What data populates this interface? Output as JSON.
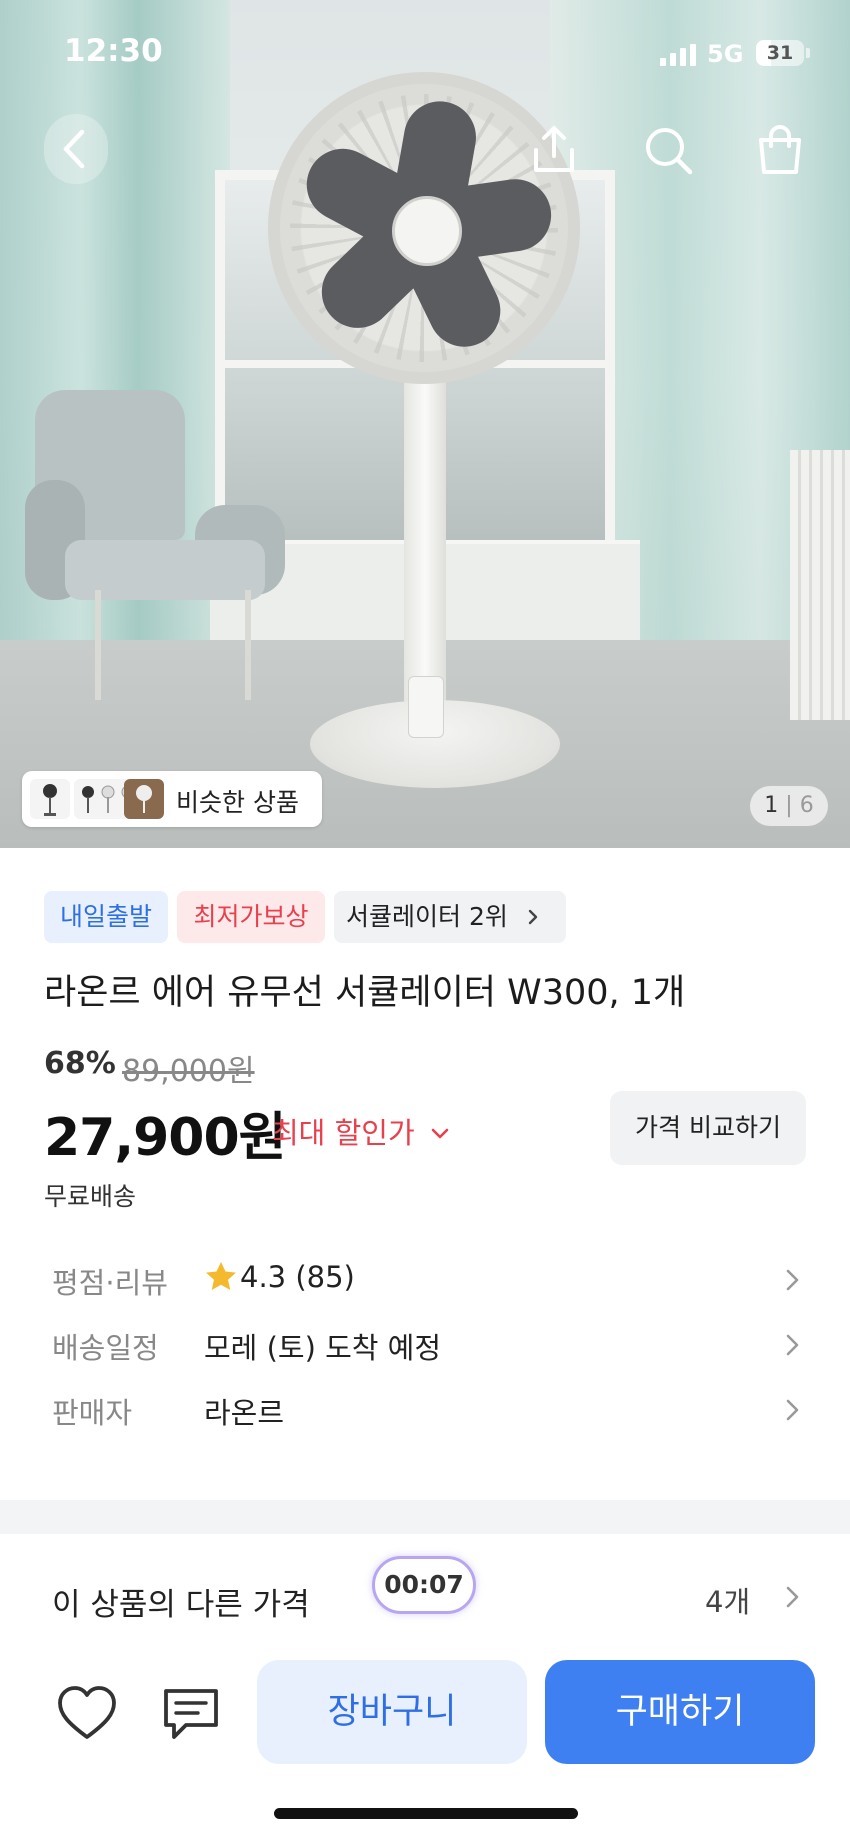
{
  "status_bar": {
    "time": "12:30",
    "network": "5G",
    "battery": "31",
    "battery_level": 0.31
  },
  "hero": {
    "similar_label": "비슷한 상품",
    "page_current": "1",
    "page_sep": "|",
    "page_total": "6"
  },
  "badges": {
    "delivery": "내일출발",
    "lowest_price": "최저가보상",
    "ranking": "서큘레이터 2위"
  },
  "product": {
    "title": "라온르 에어 유무선 서큘레이터 W300, 1개",
    "discount_rate": "68%",
    "original_price": "89,000원",
    "price": "27,900원",
    "max_discount_label": "최대 할인가",
    "compare_button": "가격 비교하기",
    "shipping": "무료배송"
  },
  "info": {
    "rating_label": "평점·리뷰",
    "rating_value": "4.3 (85)",
    "delivery_label": "배송일정",
    "delivery_value": "모레 (토) 도착 예정",
    "seller_label": "판매자",
    "seller_value": "라온르"
  },
  "other_prices": {
    "label": "이 상품의 다른 가격",
    "timer": "00:07",
    "count": "4개"
  },
  "actions": {
    "cart": "장바구니",
    "buy": "구매하기"
  },
  "colors": {
    "accent_blue": "#3e7ff1",
    "accent_red": "#e8404d",
    "star": "#f5b92e"
  }
}
